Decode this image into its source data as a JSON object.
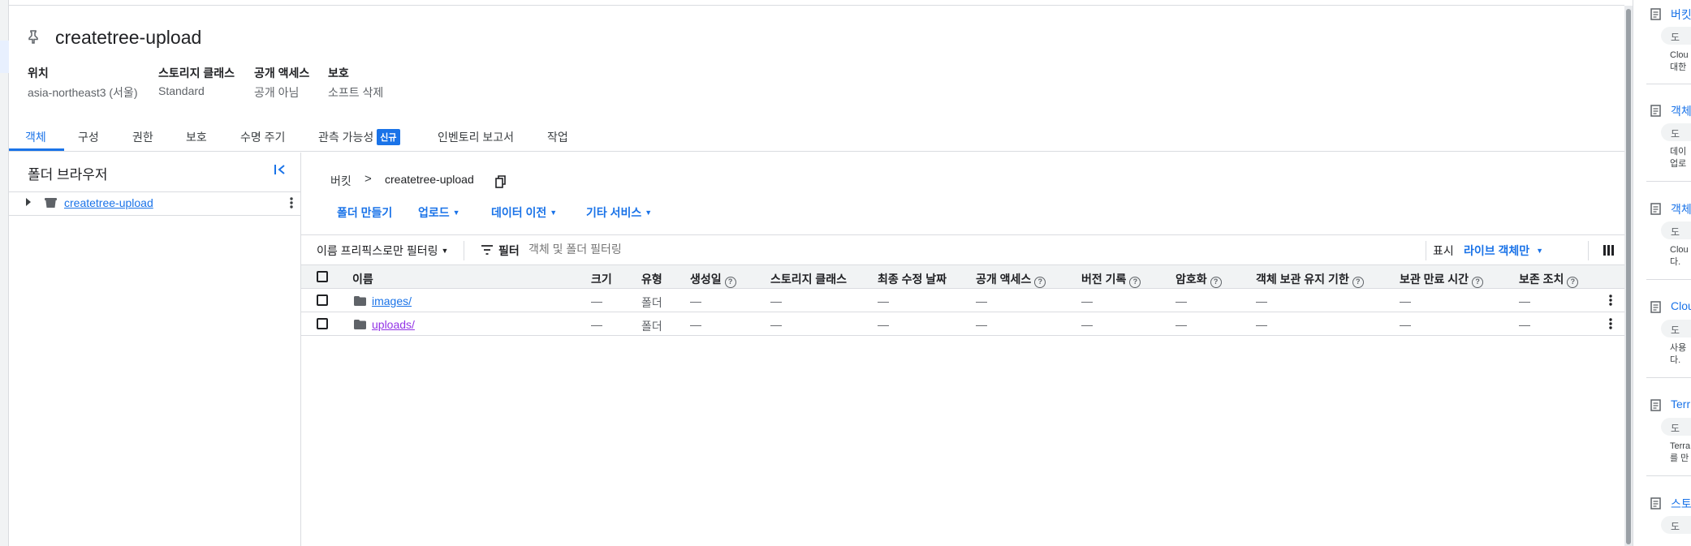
{
  "bucket": {
    "name": "createtree-upload",
    "meta": [
      {
        "label": "위치",
        "value": "asia-northeast3 (서울)"
      },
      {
        "label": "스토리지 클래스",
        "value": "Standard"
      },
      {
        "label": "공개 액세스",
        "value": "공개 아님"
      },
      {
        "label": "보호",
        "value": "소프트 삭제"
      }
    ]
  },
  "tabs": [
    {
      "label": "객체",
      "active": true
    },
    {
      "label": "구성"
    },
    {
      "label": "권한"
    },
    {
      "label": "보호"
    },
    {
      "label": "수명 주기"
    },
    {
      "label": "관측 가능성",
      "badge": "신규"
    },
    {
      "label": "인벤토리 보고서"
    },
    {
      "label": "작업"
    }
  ],
  "folder_browser": {
    "title": "폴더 브라우저",
    "bucket_link": "createtree-upload"
  },
  "breadcrumb": {
    "root": "버킷",
    "separator": ">",
    "current": "createtree-upload"
  },
  "actions": {
    "create_folder": "폴더 만들기",
    "upload": "업로드",
    "transfer": "데이터 이전",
    "other": "기타 서비스"
  },
  "filter_bar": {
    "prefix_filter": "이름 프리픽스로만 필터링",
    "filter_label": "필터",
    "filter_placeholder": "객체 및 폴더 필터링",
    "show_label": "표시",
    "show_value": "라이브 객체만"
  },
  "table": {
    "headers": [
      "이름",
      "크기",
      "유형",
      "생성일",
      "스토리지 클래스",
      "최종 수정 날짜",
      "공개 액세스",
      "버전 기록",
      "암호화",
      "객체 보관 유지 기한",
      "보관 만료 시간",
      "보존 조치"
    ],
    "rows": [
      {
        "name": "images/",
        "size": "—",
        "type": "폴더",
        "created": "—",
        "storage_class": "—",
        "modified": "—",
        "public": "—",
        "version": "—",
        "encryption": "—",
        "retention_until": "—",
        "hold_expiry": "—",
        "hold": "—"
      },
      {
        "name": "uploads/",
        "size": "—",
        "type": "폴더",
        "created": "—",
        "storage_class": "—",
        "modified": "—",
        "public": "—",
        "version": "—",
        "encryption": "—",
        "retention_until": "—",
        "hold_expiry": "—",
        "hold": "—"
      }
    ]
  },
  "right_panel": {
    "items": [
      {
        "title": "버킷",
        "chip": "도",
        "desc": [
          "Clou",
          "대한"
        ]
      },
      {
        "title": "객체",
        "chip": "도",
        "desc": [
          "데이",
          "업로"
        ]
      },
      {
        "title": "객체",
        "chip": "도",
        "desc": [
          "Clou",
          "다."
        ]
      },
      {
        "title": "Clou",
        "chip": "도",
        "desc": [
          "사용",
          "다."
        ]
      },
      {
        "title": "Terr",
        "chip": "도",
        "desc": [
          "Terra",
          "를 만"
        ]
      },
      {
        "title": "스토",
        "chip": "도",
        "desc": []
      }
    ]
  },
  "colors": {
    "accent": "#1a73e8",
    "visited_link": "#9334e6",
    "border": "#dadce0",
    "header_bg": "#f1f3f4"
  },
  "icons": [
    "pin-icon",
    "collapse-panel-icon",
    "expand-arrow-icon",
    "bucket-icon",
    "more-vert-icon",
    "copy-icon",
    "filter-icon",
    "column-display-icon",
    "folder-icon",
    "help-icon",
    "document-icon"
  ]
}
